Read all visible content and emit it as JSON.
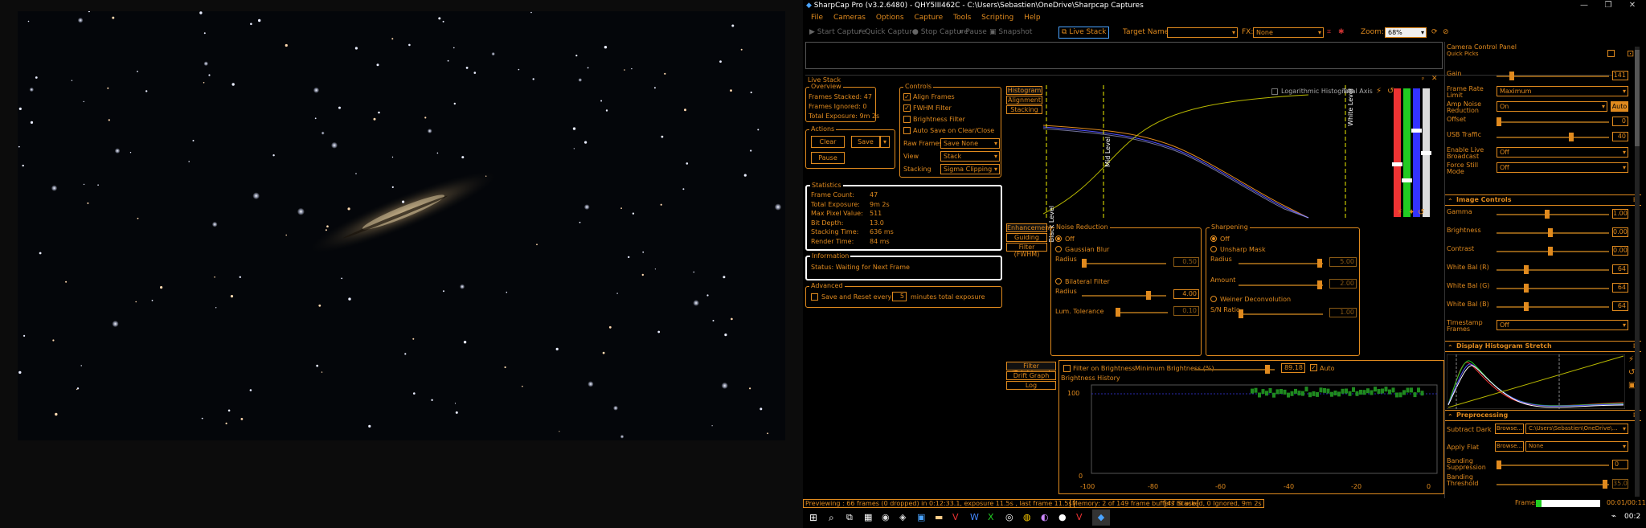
{
  "window": {
    "title": "SharpCap Pro (v3.2.6480) - QHY5III462C - C:\\Users\\Sebastien\\OneDrive\\Sharpcap Captures",
    "minimize": "—",
    "maximize": "❐",
    "close": "✕"
  },
  "menu": [
    "File",
    "Cameras",
    "Options",
    "Capture",
    "Tools",
    "Scripting",
    "Help"
  ],
  "toolbar": {
    "start_capture": "Start Capture",
    "quick_capture": "Quick Capture",
    "stop_capture": "Stop Capture",
    "pause": "Pause",
    "snapshot": "Snapshot",
    "live_stack": "Live Stack",
    "target_name_label": "Target Name :",
    "target_name_value": "",
    "fx_label": "FX:",
    "fx_value": "None",
    "zoom_label": "Zoom:",
    "zoom_value": "68%"
  },
  "livestack": {
    "title": "Live Stack",
    "overview": {
      "title": "Overview",
      "frames_stacked": "Frames Stacked: 47",
      "frames_ignored": "Frames Ignored:  0",
      "total_exposure": "Total Exposure:   9m 2s"
    },
    "actions": {
      "title": "Actions",
      "clear": "Clear",
      "save": "Save",
      "pause": "Pause"
    },
    "controls": {
      "title": "Controls",
      "align_frames": "Align Frames",
      "fwhm_filter": "FWHM Filter",
      "brightness_filter": "Brightness Filter",
      "auto_save": "Auto Save on Clear/Close",
      "raw_frames_label": "Raw Frames",
      "raw_frames_value": "Save None",
      "view_label": "View",
      "view_value": "Stack",
      "stacking_label": "Stacking",
      "stacking_value": "Sigma Clipping"
    },
    "statistics": {
      "title": "Statistics",
      "rows": [
        {
          "label": "Frame Count:",
          "value": "47"
        },
        {
          "label": "Total Exposure:",
          "value": "9m 2s"
        },
        {
          "label": "Max Pixel Value:",
          "value": "511"
        },
        {
          "label": "Bit Depth:",
          "value": "13.0"
        },
        {
          "label": "Stacking Time:",
          "value": "636 ms"
        },
        {
          "label": "Render Time:",
          "value": "84 ms"
        }
      ]
    },
    "information": {
      "title": "Information",
      "status": "Status: Waiting for Next Frame"
    },
    "advanced": {
      "title": "Advanced",
      "save_reset": "Save and Reset every",
      "minutes_value": "5",
      "minutes_label": "minutes total exposure"
    }
  },
  "histogram_panel": {
    "tabs": [
      "Histogram",
      "Alignment",
      "Stacking"
    ],
    "log_label": "Logarithmic Histogram",
    "total_axis": "Total Axis",
    "black_level": "Black Level",
    "mid_level": "Mid Level",
    "white_level": "White Level"
  },
  "enhancement": {
    "tabs": [
      "Enhancement",
      "Guiding",
      "Filter (FWHM)"
    ],
    "noise_reduction": {
      "title": "Noise Reduction",
      "off": "Off",
      "gaussian": "Gaussian Blur",
      "radius_label": "Radius",
      "radius_value": "0.50",
      "bilateral": "Bilateral Filter",
      "radius2_label": "Radius",
      "radius2_value": "4.00",
      "lum_label": "Lum. Tolerance",
      "lum_value": "0.10"
    },
    "sharpening": {
      "title": "Sharpening",
      "off": "Off",
      "unsharp": "Unsharp Mask",
      "radius_label": "Radius",
      "radius_value": "5.00",
      "amount_label": "Amount",
      "amount_value": "2.00",
      "weiner": "Weiner Deconvolution",
      "snr_label": "S/N Ratio",
      "snr_value": "1.00"
    }
  },
  "brightness": {
    "tabs": [
      "Filter (Brightness)",
      "Drift Graph",
      "Log"
    ],
    "filter_label": "Filter on Brightness",
    "min_label": "Minimum Brightness (%)",
    "min_value": "89.18",
    "auto_label": "Auto",
    "history_title": "Brightness History",
    "y_tick": "100",
    "y_zero": "0",
    "x_ticks": [
      "-100",
      "-80",
      "-60",
      "-40",
      "-20",
      "0"
    ]
  },
  "camera_panel": {
    "title": "Camera Control Panel",
    "quick_picks": "Quick Picks",
    "rows": [
      {
        "label": "Gain",
        "value": "141",
        "pos": 0.12
      },
      {
        "label": "Frame Rate Limit",
        "value": "Maximum",
        "type": "select"
      },
      {
        "label": "Amp Noise Reduction",
        "value": "On",
        "type": "select",
        "extra": "Auto"
      },
      {
        "label": "Offset",
        "value": "0",
        "pos": 0.0
      },
      {
        "label": "USB Traffic",
        "value": "40",
        "pos": 0.67
      },
      {
        "label": "Enable Live Broadcast",
        "value": "Off",
        "type": "select"
      },
      {
        "label": "Force Still Mode",
        "value": "Off",
        "type": "select"
      }
    ],
    "image_controls_title": "Image Controls",
    "image_rows": [
      {
        "label": "Gamma",
        "value": "1.00",
        "pos": 0.45
      },
      {
        "label": "Brightness",
        "value": "0.00",
        "pos": 0.48
      },
      {
        "label": "Contrast",
        "value": "0.00",
        "pos": 0.48
      },
      {
        "label": "White Bal (R)",
        "value": "64",
        "pos": 0.25
      },
      {
        "label": "White Bal (G)",
        "value": "64",
        "pos": 0.25
      },
      {
        "label": "White Bal (B)",
        "value": "64",
        "pos": 0.25
      },
      {
        "label": "Timestamp Frames",
        "value": "Off",
        "type": "select"
      }
    ],
    "display_hist_title": "Display Histogram Stretch",
    "preprocessing_title": "Preprocessing",
    "subtract_dark_label": "Subtract Dark",
    "browse": "Browse...",
    "subtract_dark_value": "C:\\Users\\Sebastien\\OneDrive\\...",
    "apply_flat_label": "Apply Flat",
    "apply_flat_value": "None",
    "banding_sup_label": "Banding Suppression",
    "banding_sup_value": "0",
    "banding_thr_label": "Banding Threshold",
    "banding_thr_value": "35.0"
  },
  "status": {
    "left": "Previewing : 66 frames (0 dropped) in 0:12:33.1, exposure 11.5s , last frame 11.5s",
    "memory": "Memory: 2 of 149 frame buffers in use",
    "stacked": "47 Stacked, 0 Ignored, 9m 2s",
    "frame_label": "Frame:",
    "frame_time": "00:01/00:11"
  },
  "taskbar": {
    "clock": "00:2"
  },
  "colors": {
    "accent": "#e08a1e",
    "background": "#000000"
  }
}
